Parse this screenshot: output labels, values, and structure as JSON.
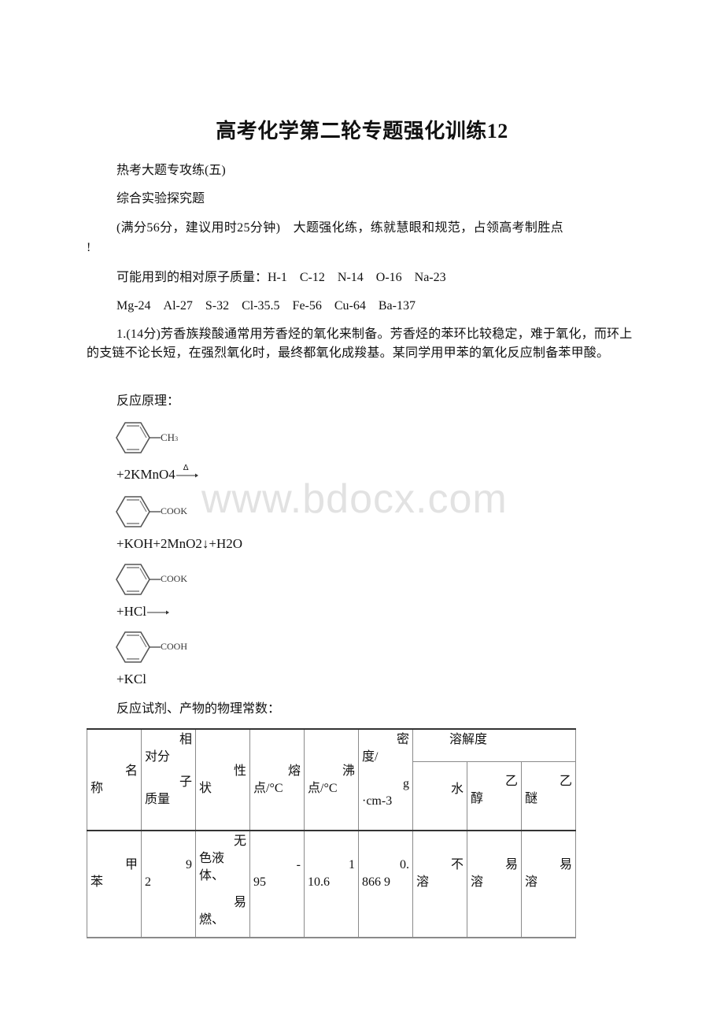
{
  "document": {
    "title": "高考化学第二轮专题强化训练12",
    "watermark": "www.bdocx.com",
    "paragraphs": {
      "series": "热考大题专攻练(五)",
      "topic": "综合实验探究题",
      "scoring_line1": "(满分56分，建议用时25分钟)　大题强化练，练就慧眼和规范，占领高考制胜点",
      "scoring_line2": "!",
      "atomic_mass_line1": "可能用到的相对原子质量：H-1　C-12　N-14　O-16　Na-23",
      "atomic_mass_line2": "Mg-24　Al-27　S-32　Cl-35.5　Fe-56　Cu-64　Ba-137",
      "question1": "1.(14分)芳香族羧酸通常用芳香烃的氧化来制备。芳香烃的苯环比较稳定，难于氧化，而环上的支链不论长短，在强烈氧化时，最终都氧化成羧基。某同学用甲苯的氧化反应制备苯甲酸。",
      "reaction_principle_label": "反应原理：",
      "constants_label": "反应试剂、产物的物理常数："
    },
    "reaction": {
      "mol1_substituent": "CH",
      "mol1_subscript": "3",
      "step1_reagent": "+2KMnO4",
      "step1_condition": "Δ",
      "mol2_substituent": "COOK",
      "step1_byproducts": "+KOH+2MnO2↓+H2O",
      "mol3_substituent": "COOK",
      "step2_reagent": "+HCl",
      "mol4_substituent": "COOH",
      "step2_byproduct": "+KCl"
    },
    "table": {
      "headers": {
        "name": [
          "名",
          "称"
        ],
        "molar_mass": [
          "相",
          "对分",
          "子",
          "质量"
        ],
        "appearance": [
          "性",
          "状"
        ],
        "melting_point": [
          "熔",
          "点/°C"
        ],
        "boiling_point": [
          "沸",
          "点/°C"
        ],
        "density": [
          "密",
          "度/",
          "g",
          "·cm-3"
        ],
        "solubility": "溶解度",
        "solubility_water": "水",
        "solubility_ethanol": [
          "乙",
          "醇"
        ],
        "solubility_ether": [
          "乙",
          "醚"
        ]
      },
      "rows": [
        {
          "name": [
            "甲",
            "苯"
          ],
          "molar_mass": [
            "9",
            "2"
          ],
          "appearance": [
            "无",
            "色液",
            "体、",
            "易",
            "燃、"
          ],
          "melting_point": [
            "-",
            "95"
          ],
          "boiling_point": [
            "1",
            "10.6"
          ],
          "density": [
            "0.",
            "866 9"
          ],
          "water": [
            "不",
            "溶"
          ],
          "ethanol": [
            "易",
            "溶"
          ],
          "ether": [
            "易",
            "溶"
          ]
        }
      ]
    }
  }
}
